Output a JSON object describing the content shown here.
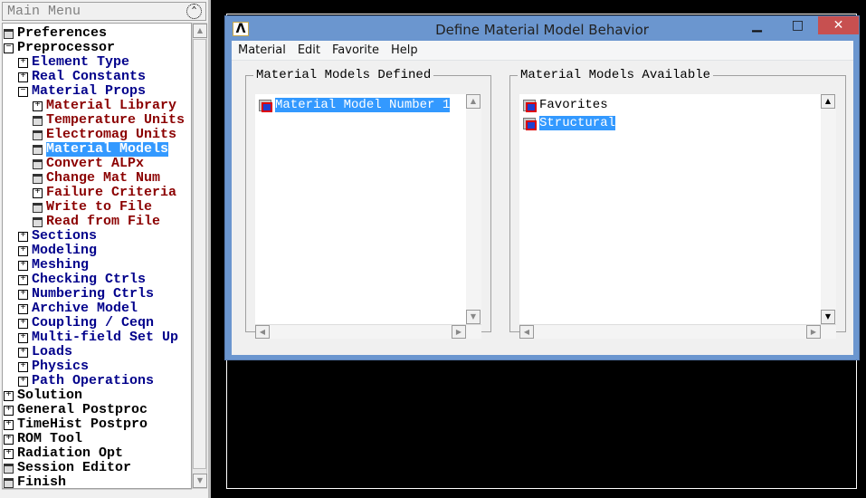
{
  "main_menu": {
    "title": "Main Menu",
    "items": [
      {
        "label": "Preferences",
        "level": 0,
        "icon": "calc"
      },
      {
        "label": "Preprocessor",
        "level": 0,
        "icon": "minus"
      },
      {
        "label": "Element Type",
        "level": 1,
        "icon": "plus"
      },
      {
        "label": "Real Constants",
        "level": 1,
        "icon": "plus"
      },
      {
        "label": "Material Props",
        "level": 1,
        "icon": "minus"
      },
      {
        "label": "Material Library",
        "level": 2,
        "icon": "plus"
      },
      {
        "label": "Temperature Units",
        "level": 2,
        "icon": "calc"
      },
      {
        "label": "Electromag Units",
        "level": 2,
        "icon": "calc"
      },
      {
        "label": "Material Models",
        "level": 2,
        "icon": "calc",
        "selected": true
      },
      {
        "label": "Convert ALPx",
        "level": 2,
        "icon": "calc"
      },
      {
        "label": "Change Mat Num",
        "level": 2,
        "icon": "calc"
      },
      {
        "label": "Failure Criteria",
        "level": 2,
        "icon": "plus"
      },
      {
        "label": "Write to File",
        "level": 2,
        "icon": "calc"
      },
      {
        "label": "Read from File",
        "level": 2,
        "icon": "calc"
      },
      {
        "label": "Sections",
        "level": 1,
        "icon": "plus"
      },
      {
        "label": "Modeling",
        "level": 1,
        "icon": "plus"
      },
      {
        "label": "Meshing",
        "level": 1,
        "icon": "plus"
      },
      {
        "label": "Checking Ctrls",
        "level": 1,
        "icon": "plus"
      },
      {
        "label": "Numbering Ctrls",
        "level": 1,
        "icon": "plus"
      },
      {
        "label": "Archive Model",
        "level": 1,
        "icon": "plus"
      },
      {
        "label": "Coupling / Ceqn",
        "level": 1,
        "icon": "plus"
      },
      {
        "label": "Multi-field Set Up",
        "level": 1,
        "icon": "plus"
      },
      {
        "label": "Loads",
        "level": 1,
        "icon": "plus"
      },
      {
        "label": "Physics",
        "level": 1,
        "icon": "plus"
      },
      {
        "label": "Path Operations",
        "level": 1,
        "icon": "plus"
      },
      {
        "label": "Solution",
        "level": 0,
        "icon": "plus"
      },
      {
        "label": "General Postproc",
        "level": 0,
        "icon": "plus"
      },
      {
        "label": "TimeHist Postpro",
        "level": 0,
        "icon": "plus"
      },
      {
        "label": "ROM Tool",
        "level": 0,
        "icon": "plus"
      },
      {
        "label": "Radiation Opt",
        "level": 0,
        "icon": "plus"
      },
      {
        "label": "Session Editor",
        "level": 0,
        "icon": "calc"
      },
      {
        "label": "Finish",
        "level": 0,
        "icon": "calc"
      }
    ]
  },
  "dialog": {
    "title": "Define Material Model Behavior",
    "logo": "Λ",
    "menu": [
      "Material",
      "Edit",
      "Favorite",
      "Help"
    ],
    "defined": {
      "label": "Material Models Defined",
      "items": [
        "Material Model Number 1"
      ]
    },
    "available": {
      "label": "Material Models Available",
      "items": [
        "Favorites",
        "Structural"
      ]
    }
  },
  "colors": {
    "selection": "#3399ff",
    "titlebar": "#6b96cf",
    "close": "#c75050"
  }
}
